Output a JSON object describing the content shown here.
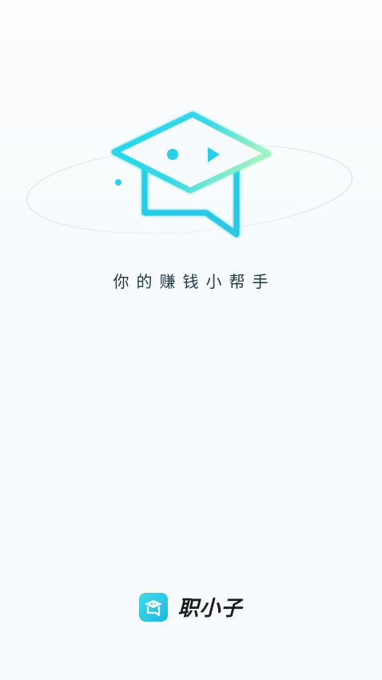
{
  "splash": {
    "tagline": "你的赚钱小帮手",
    "brand_name": "职小子"
  },
  "icons": {
    "hero": "graduation-cap-chat-bubble-logo",
    "brand": "graduation-cap-logo"
  },
  "colors": {
    "accent_cyan": "#2fd3e6",
    "accent_green": "#8ef0c8",
    "tagline_text": "#1f3a44",
    "brand_text": "#1b1b1b",
    "background": "#f7fbfd"
  }
}
